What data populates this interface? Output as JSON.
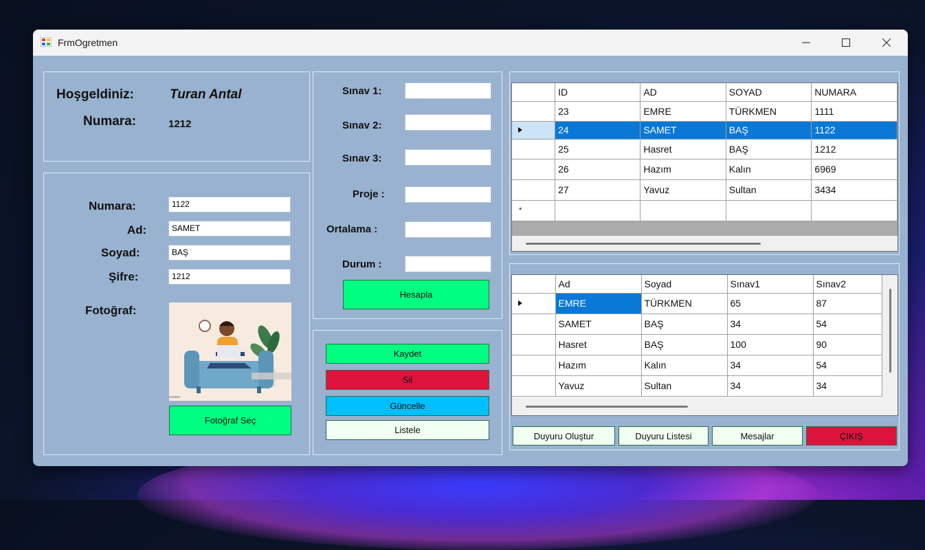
{
  "window": {
    "title": "FrmOgretmen"
  },
  "welcome": {
    "label": "Hoşgeldiniz:",
    "name": "Turan Antal",
    "number_label": "Numara:",
    "number": "1212"
  },
  "student_form": {
    "numara_label": "Numara:",
    "numara_value": "1122",
    "ad_label": "Ad:",
    "ad_value": "SAMET",
    "soyad_label": "Soyad:",
    "soyad_value": "BAŞ",
    "sifre_label": "Şifre:",
    "sifre_value": "1212",
    "foto_label": "Fotoğraf:",
    "foto_button": "Fotoğraf Seç"
  },
  "exam_form": {
    "sinav1_label": "Sınav 1:",
    "sinav2_label": "Sınav 2:",
    "sinav3_label": "Sınav 3:",
    "proje_label": "Proje :",
    "ortalama_label": "Ortalama :",
    "durum_label": "Durum :",
    "hesapla_button": "Hesapla"
  },
  "actions": {
    "kaydet": "Kaydet",
    "sil": "Sil",
    "guncelle": "Güncelle",
    "listele": "Listele"
  },
  "students_grid": {
    "headers": [
      "ID",
      "AD",
      "SOYAD",
      "NUMARA"
    ],
    "rows": [
      [
        "23",
        "EMRE",
        "TÜRKMEN",
        "1111"
      ],
      [
        "24",
        "SAMET",
        "BAŞ",
        "1122"
      ],
      [
        "25",
        "Hasret",
        "BAŞ",
        "1212"
      ],
      [
        "26",
        "Hazım",
        "Kalın",
        "6969"
      ],
      [
        "27",
        "Yavuz",
        "Sultan",
        "3434"
      ]
    ],
    "new_row_marker": "*"
  },
  "grades_grid": {
    "headers": [
      "Ad",
      "Soyad",
      "Sınav1",
      "Sınav2"
    ],
    "rows": [
      [
        "EMRE",
        "TÜRKMEN",
        "65",
        "87"
      ],
      [
        "SAMET",
        "BAŞ",
        "34",
        "54"
      ],
      [
        "Hasret",
        "BAŞ",
        "100",
        "90"
      ],
      [
        "Hazım",
        "Kalın",
        "34",
        "54"
      ],
      [
        "Yavuz",
        "Sultan",
        "34",
        "34"
      ]
    ]
  },
  "bottom_buttons": {
    "duyuru_olustur": "Duyuru Oluştur",
    "duyuru_listesi": "Duyuru Listesi",
    "mesajlar": "Mesajlar",
    "cikis": "ÇIKIŞ"
  },
  "colors": {
    "form_bg": "#98b2d0",
    "green": "#00ff80",
    "red": "#dc143c",
    "blue": "#00bfff",
    "mint": "#f0fff0",
    "selection": "#0a78d7"
  }
}
